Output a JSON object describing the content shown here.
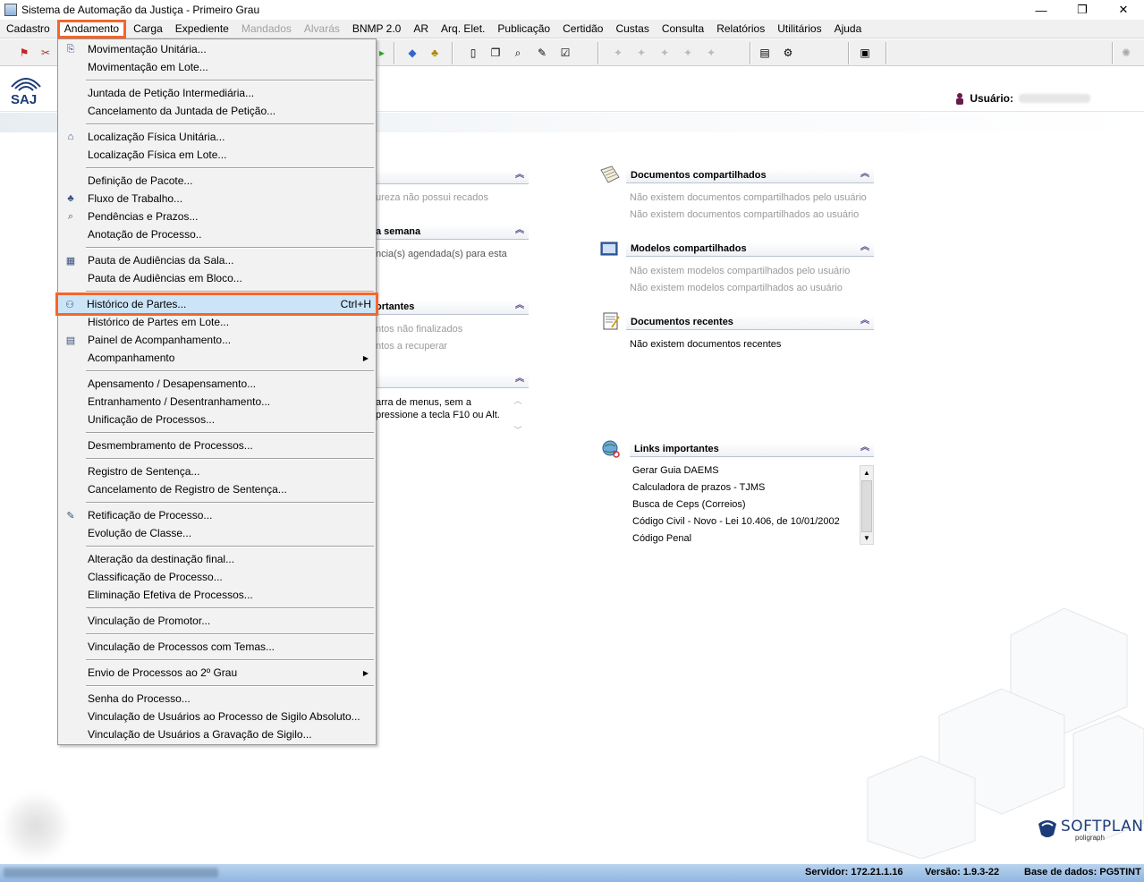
{
  "window": {
    "title": "Sistema de Automação da Justiça - Primeiro Grau",
    "minimize": "—",
    "restore": "❐",
    "close": "✕"
  },
  "menubar": [
    {
      "label": "Cadastro",
      "state": "normal"
    },
    {
      "label": "Andamento",
      "state": "active"
    },
    {
      "label": "Carga",
      "state": "normal"
    },
    {
      "label": "Expediente",
      "state": "normal"
    },
    {
      "label": "Mandados",
      "state": "disabled"
    },
    {
      "label": "Alvarás",
      "state": "disabled"
    },
    {
      "label": "BNMP 2.0",
      "state": "normal"
    },
    {
      "label": "AR",
      "state": "normal"
    },
    {
      "label": "Arq. Elet.",
      "state": "normal"
    },
    {
      "label": "Publicação",
      "state": "normal"
    },
    {
      "label": "Certidão",
      "state": "normal"
    },
    {
      "label": "Custas",
      "state": "normal"
    },
    {
      "label": "Consulta",
      "state": "normal"
    },
    {
      "label": "Relatórios",
      "state": "normal"
    },
    {
      "label": "Utilitários",
      "state": "normal"
    },
    {
      "label": "Ajuda",
      "state": "normal"
    }
  ],
  "header": {
    "logo_text": "SAJ",
    "user_label": "Usuário:"
  },
  "panels": {
    "left": {
      "p1_title": "",
      "p1_text": "ureza não possui recados",
      "p2_title": "a semana",
      "p2_text": "ncia(s) agendada(s) para esta",
      "p3_title": "ortantes",
      "p3_text1": "ntos não finalizados",
      "p3_text2": "ntos a recuperar",
      "p4_text1": "arra de menus, sem a",
      "p4_text2": "pressione a tecla F10 ou Alt."
    },
    "documentos_compartilhados": {
      "title": "Documentos compartilhados",
      "line1": "Não existem documentos compartilhados pelo usuário",
      "line2": "Não existem documentos compartilhados ao usuário"
    },
    "modelos_compartilhados": {
      "title": "Modelos compartilhados",
      "line1": "Não existem modelos compartilhados pelo usuário",
      "line2": "Não existem modelos compartilhados ao usuário"
    },
    "documentos_recentes": {
      "title": "Documentos recentes",
      "line1": "Não existem documentos recentes"
    },
    "links_importantes": {
      "title": "Links importantes",
      "items": [
        "Gerar Guia DAEMS",
        "Calculadora de prazos - TJMS",
        "Busca de Ceps (Correios)",
        "Código Civil - Novo - Lei 10.406, de 10/01/2002",
        "Código Penal"
      ]
    }
  },
  "dropdown": {
    "groups": [
      [
        "Movimentação Unitária...",
        "Movimentação em Lote..."
      ],
      [
        "Juntada de Petição Intermediária...",
        "Cancelamento da Juntada de Petição..."
      ],
      [
        "Localização Física Unitária...",
        "Localização Física em Lote..."
      ],
      [
        "Definição de Pacote...",
        "Fluxo de Trabalho...",
        "Pendências e Prazos...",
        "Anotação de Processo.."
      ],
      [
        "Pauta de Audiências da Sala...",
        "Pauta de Audiências em Bloco..."
      ],
      [
        "Histórico de Partes...",
        "Histórico de Partes em Lote...",
        "Painel de Acompanhamento...",
        "Acompanhamento"
      ],
      [
        "Apensamento / Desapensamento...",
        "Entranhamento / Desentranhamento...",
        "Unificação de Processos..."
      ],
      [
        "Desmembramento de Processos..."
      ],
      [
        "Registro de Sentença...",
        "Cancelamento de Registro de Sentença..."
      ],
      [
        "Retificação de Processo...",
        "Evolução de Classe..."
      ],
      [
        "Alteração da destinação final...",
        "Classificação de Processo...",
        "Eliminação Efetiva de Processos..."
      ],
      [
        "Vinculação de Promotor..."
      ],
      [
        "Vinculação de Processos com Temas..."
      ],
      [
        "Envio de Processos ao 2º Grau"
      ],
      [
        "Senha do Processo...",
        "Vinculação de Usuários ao Processo de Sigilo Absoluto...",
        "Vinculação de Usuários a Gravação de Sigilo..."
      ]
    ],
    "highlighted": "Histórico de Partes...",
    "highlighted_shortcut": "Ctrl+H",
    "submenu_items": [
      "Acompanhamento",
      "Envio de Processos ao 2º Grau"
    ]
  },
  "softplan": {
    "word": "SOFTPLAN",
    "sub": "poligraph"
  },
  "statusbar": {
    "servidor": "Servidor: 172.21.1.16",
    "versao": "Versão: 1.9.3-22",
    "base": "Base de dados: PG5TINT"
  },
  "colors": {
    "highlight_outline": "#f4662c",
    "menu_highlight": "#cce4f7",
    "statusbar": "#9bbfe6",
    "brand": "#1d3b78"
  }
}
